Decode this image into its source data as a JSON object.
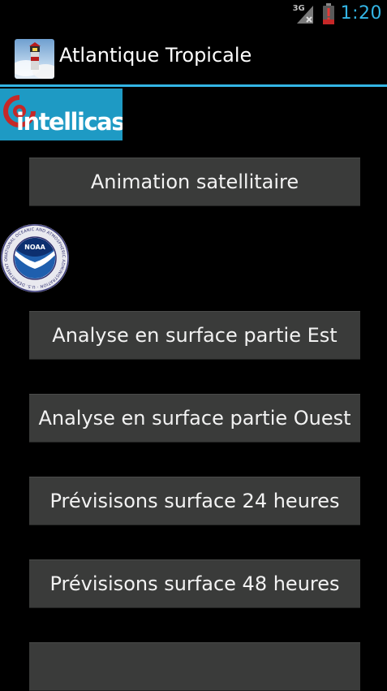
{
  "status_bar": {
    "network_label": "3G",
    "time": "1:20",
    "icons": [
      "signal-icon",
      "battery-low-icon"
    ],
    "accent_color": "#33b5e5"
  },
  "action_bar": {
    "title": "Atlantique Tropicale",
    "icon": "app-lighthouse-icon",
    "divider_color": "#33b5e5"
  },
  "intellicast": {
    "logo_text": "intellicast",
    "brand_color": "#1e9ac4"
  },
  "noaa": {
    "logo_text": "NOAA",
    "ring_text": "NATIONAL OCEANIC AND ATMOSPHERIC ADMINISTRATION · U.S. DEPARTMENT OF COMMERCE"
  },
  "buttons": [
    {
      "label": "Animation satellitaire"
    },
    {
      "label": "Analyse en surface partie Est"
    },
    {
      "label": "Analyse en surface partie Ouest"
    },
    {
      "label": "Prévisisons surface 24 heures"
    },
    {
      "label": "Prévisisons surface 48 heures"
    },
    {
      "label": ""
    }
  ],
  "colors": {
    "background": "#000000",
    "button_bg": "#3a3b3a",
    "button_text": "#f2f2f2"
  }
}
